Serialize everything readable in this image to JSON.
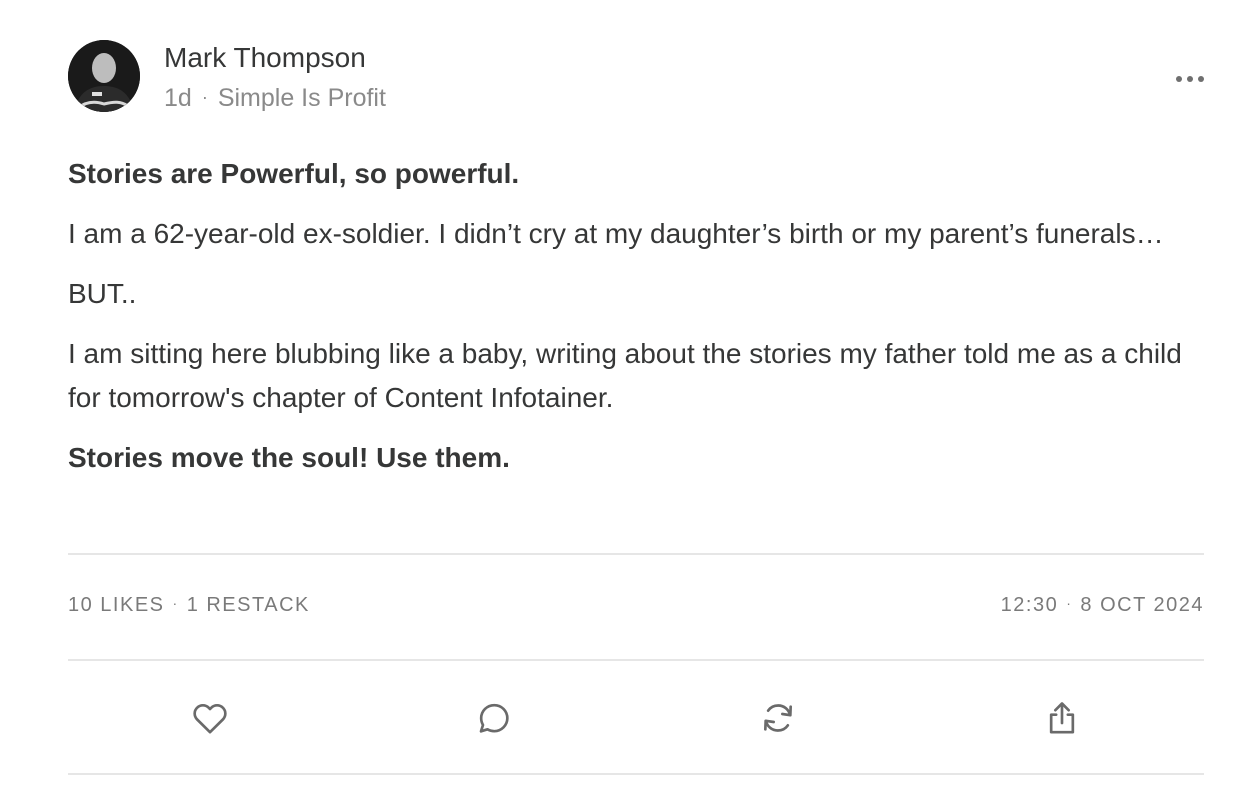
{
  "author": {
    "name": "Mark Thompson",
    "age": "1d",
    "separator": "·",
    "publication": "Simple Is Profit"
  },
  "post": {
    "paragraphs": [
      "Stories are Powerful, so powerful.",
      "I am a 62-year-old ex-soldier. I didn’t cry at my daughter’s birth or my parent’s funerals…",
      "BUT..",
      "I am sitting here blubbing like a baby, writing about the stories my father told me as a child for tomorrow's chapter of Content Infotainer.",
      "Stories move the soul! Use them."
    ]
  },
  "stats": {
    "likes": "10 LIKES",
    "restacks": "1 RESTACK",
    "time": "12:30",
    "date": "8 OCT 2024",
    "separator": "·"
  },
  "icons": {
    "more": "more-options-icon",
    "like": "heart-icon",
    "comment": "comment-icon",
    "restack": "restack-icon",
    "share": "share-icon"
  },
  "colors": {
    "text": "#363737",
    "muted": "#8a8a8a",
    "divider": "#e6e6e6",
    "icon": "#6a6a6a"
  }
}
